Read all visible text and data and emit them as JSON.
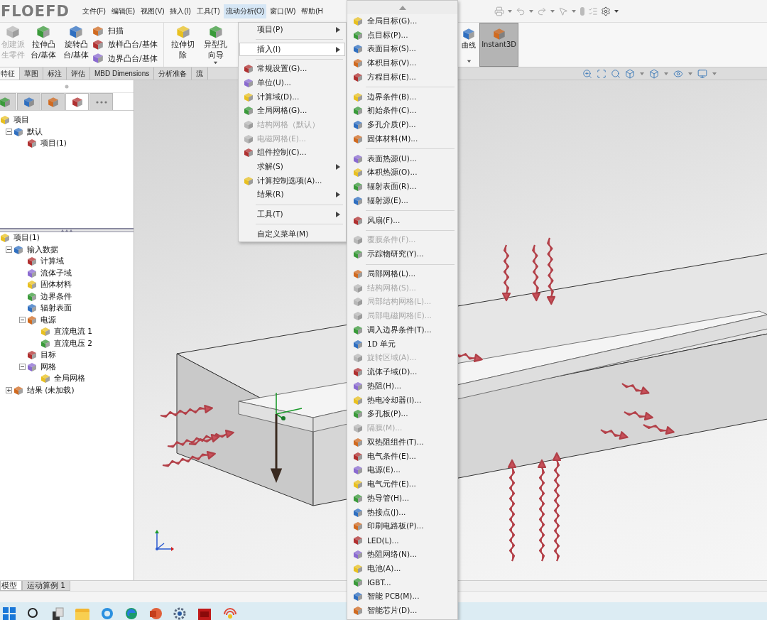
{
  "logo": "FLOEFD",
  "menu_bar": [
    {
      "label": "文件(F)",
      "selected": false
    },
    {
      "label": "编辑(E)",
      "selected": false
    },
    {
      "label": "视图(V)",
      "selected": false
    },
    {
      "label": "插入(I)",
      "selected": false
    },
    {
      "label": "工具(T)",
      "selected": false
    },
    {
      "label": "流动分析(O)",
      "selected": true
    },
    {
      "label": "窗口(W)",
      "selected": false
    },
    {
      "label": "帮助(H",
      "selected": false
    }
  ],
  "ribbon": {
    "buttons": [
      {
        "label": "创建派生零件",
        "kind": "large",
        "disabled": true
      },
      {
        "label": "拉伸凸台/基体",
        "kind": "large",
        "disabled": false
      },
      {
        "label": "旋转凸台/基体",
        "kind": "large",
        "disabled": false
      },
      {
        "label": "扫描",
        "kind": "small",
        "disabled": false
      },
      {
        "label": "放样凸台/基体",
        "kind": "small",
        "disabled": false
      },
      {
        "label": "边界凸台/基体",
        "kind": "small",
        "disabled": false
      },
      {
        "label": "拉伸切除",
        "kind": "large",
        "disabled": false
      },
      {
        "label": "异型孔向导",
        "kind": "large",
        "disabled": false,
        "dropdown": true
      }
    ],
    "extra": [
      {
        "label": "曲线",
        "selected": false,
        "dropdown": true
      },
      {
        "label": "Instant3D",
        "selected": true
      }
    ]
  },
  "command_tabs": [
    {
      "label": "特征",
      "selected": true
    },
    {
      "label": "草图",
      "selected": false
    },
    {
      "label": "标注",
      "selected": false
    },
    {
      "label": "评估",
      "selected": false
    },
    {
      "label": "MBD Dimensions",
      "selected": false
    },
    {
      "label": "分析准备",
      "selected": false
    },
    {
      "label": "流",
      "selected": false
    }
  ],
  "panel_tabs": [
    {
      "selected": false
    },
    {
      "selected": false
    },
    {
      "selected": false
    },
    {
      "selected": true
    },
    {
      "selected": false
    }
  ],
  "feature_tree": [
    {
      "label": "项目",
      "children": [
        {
          "label": "默认",
          "expanded": true,
          "children": [
            {
              "label": "项目(1)"
            }
          ]
        }
      ]
    }
  ],
  "analysis_tree": [
    {
      "label": "项目(1)",
      "children": [
        {
          "label": "输入数据",
          "expanded": true,
          "children": [
            {
              "label": "计算域"
            },
            {
              "label": "流体子域"
            },
            {
              "label": "固体材料"
            },
            {
              "label": "边界条件"
            },
            {
              "label": "辐射表面"
            },
            {
              "label": "电源",
              "expanded": true,
              "children": [
                {
                  "label": "直流电流 1"
                },
                {
                  "label": "直流电压 2"
                }
              ]
            },
            {
              "label": "目标"
            },
            {
              "label": "网格",
              "expanded": true,
              "children": [
                {
                  "label": "全局网格"
                }
              ]
            }
          ]
        },
        {
          "label": "结果 (未加载)",
          "expanded": false
        }
      ]
    }
  ],
  "flow_menu": {
    "items": [
      {
        "kind": "text_item",
        "label": "项目(P)",
        "submenu": true,
        "selected": false,
        "disabled": false
      },
      {
        "kind": "separator"
      },
      {
        "kind": "text_item",
        "label": "插入(I)",
        "submenu": true,
        "selected": true,
        "disabled": false
      },
      {
        "kind": "separator"
      },
      {
        "kind": "icon_item",
        "label": "常规设置(G)...",
        "submenu": false,
        "selected": false,
        "disabled": false
      },
      {
        "kind": "icon_item",
        "label": "单位(U)...",
        "submenu": false,
        "selected": false,
        "disabled": false
      },
      {
        "kind": "icon_item",
        "label": "计算域(D)...",
        "submenu": false,
        "selected": false,
        "disabled": false
      },
      {
        "kind": "icon_item",
        "label": "全局网格(G)...",
        "submenu": false,
        "selected": false,
        "disabled": false
      },
      {
        "kind": "icon_item",
        "label": "结构网格（默认）",
        "submenu": false,
        "selected": false,
        "disabled": true
      },
      {
        "kind": "icon_item",
        "label": "电磁网格(E)...",
        "submenu": false,
        "selected": false,
        "disabled": true
      },
      {
        "kind": "icon_item",
        "label": "组件控制(C)...",
        "submenu": false,
        "selected": false,
        "disabled": false
      },
      {
        "kind": "text_item",
        "label": "求解(S)",
        "submenu": true,
        "selected": false,
        "disabled": false
      },
      {
        "kind": "icon_item",
        "label": "计算控制选项(A)...",
        "submenu": false,
        "selected": false,
        "disabled": false
      },
      {
        "kind": "text_item",
        "label": "结果(R)",
        "submenu": true,
        "selected": false,
        "disabled": false
      },
      {
        "kind": "separator"
      },
      {
        "kind": "text_item",
        "label": "工具(T)",
        "submenu": true,
        "selected": false,
        "disabled": false
      },
      {
        "kind": "separator"
      },
      {
        "kind": "text_item",
        "label": "自定义菜单(M)",
        "submenu": false,
        "selected": false,
        "disabled": false
      }
    ]
  },
  "insert_menu": {
    "items": [
      {
        "kind": "icon_item",
        "label": "全局目标(G)...",
        "disabled": false
      },
      {
        "kind": "icon_item",
        "label": "点目标(P)...",
        "disabled": false
      },
      {
        "kind": "icon_item",
        "label": "表面目标(S)...",
        "disabled": false
      },
      {
        "kind": "icon_item",
        "label": "体积目标(V)...",
        "disabled": false
      },
      {
        "kind": "icon_item",
        "label": "方程目标(E)...",
        "disabled": false
      },
      {
        "kind": "separator"
      },
      {
        "kind": "icon_item",
        "label": "边界条件(B)...",
        "disabled": false
      },
      {
        "kind": "icon_item",
        "label": "初始条件(C)...",
        "disabled": false
      },
      {
        "kind": "icon_item",
        "label": "多孔介质(P)...",
        "disabled": false
      },
      {
        "kind": "icon_item",
        "label": "固体材料(M)...",
        "disabled": false
      },
      {
        "kind": "separator"
      },
      {
        "kind": "icon_item",
        "label": "表面热源(U)...",
        "disabled": false
      },
      {
        "kind": "icon_item",
        "label": "体积热源(O)...",
        "disabled": false
      },
      {
        "kind": "icon_item",
        "label": "辐射表面(R)...",
        "disabled": false
      },
      {
        "kind": "icon_item",
        "label": "辐射源(E)...",
        "disabled": false
      },
      {
        "kind": "separator"
      },
      {
        "kind": "icon_item",
        "label": "风扇(F)...",
        "disabled": false
      },
      {
        "kind": "separator"
      },
      {
        "kind": "icon_item",
        "label": "覆膜条件(F)...",
        "disabled": true
      },
      {
        "kind": "icon_item",
        "label": "示踪物研究(Y)...",
        "disabled": false
      },
      {
        "kind": "separator"
      },
      {
        "kind": "icon_item",
        "label": "局部网格(L)...",
        "disabled": false
      },
      {
        "kind": "icon_item",
        "label": "结构网格(S)...",
        "disabled": true
      },
      {
        "kind": "icon_item",
        "label": "局部结构网格(L)...",
        "disabled": true
      },
      {
        "kind": "icon_item",
        "label": "局部电磁网格(E)...",
        "disabled": true
      },
      {
        "kind": "icon_item",
        "label": "调入边界条件(T)...",
        "disabled": false
      },
      {
        "kind": "icon_item",
        "label": "1D 单元",
        "disabled": false
      },
      {
        "kind": "icon_item",
        "label": "旋转区域(A)...",
        "disabled": true
      },
      {
        "kind": "icon_item",
        "label": "流体子域(D)...",
        "disabled": false
      },
      {
        "kind": "icon_item",
        "label": "热阻(H)...",
        "disabled": false
      },
      {
        "kind": "icon_item",
        "label": "热电冷却器(I)...",
        "disabled": false
      },
      {
        "kind": "icon_item",
        "label": "多孔板(P)...",
        "disabled": false
      },
      {
        "kind": "icon_item",
        "label": "隔膜(M)...",
        "disabled": true
      },
      {
        "kind": "icon_item",
        "label": "双热阻组件(T)...",
        "disabled": false
      },
      {
        "kind": "icon_item",
        "label": "电气条件(E)...",
        "disabled": false
      },
      {
        "kind": "icon_item",
        "label": "电源(E)...",
        "disabled": false
      },
      {
        "kind": "icon_item",
        "label": "电气元件(E)...",
        "disabled": false
      },
      {
        "kind": "icon_item",
        "label": "热导管(H)...",
        "disabled": false
      },
      {
        "kind": "icon_item",
        "label": "热接点(J)...",
        "disabled": false
      },
      {
        "kind": "icon_item",
        "label": "印刷电路板(P)...",
        "disabled": false
      },
      {
        "kind": "icon_item",
        "label": "LED(L)...",
        "disabled": false
      },
      {
        "kind": "icon_item",
        "label": "热阻网络(N)...",
        "disabled": false
      },
      {
        "kind": "icon_item",
        "label": "电池(A)...",
        "disabled": false
      },
      {
        "kind": "icon_item",
        "label": "IGBT...",
        "disabled": false
      },
      {
        "kind": "icon_item",
        "label": "智能 PCB(M)...",
        "disabled": false
      },
      {
        "kind": "icon_item",
        "label": "智能芯片(D)...",
        "disabled": false
      }
    ]
  },
  "bottom_tabs": [
    {
      "label": "模型",
      "selected": true
    },
    {
      "label": "运动算例 1",
      "selected": false
    }
  ]
}
